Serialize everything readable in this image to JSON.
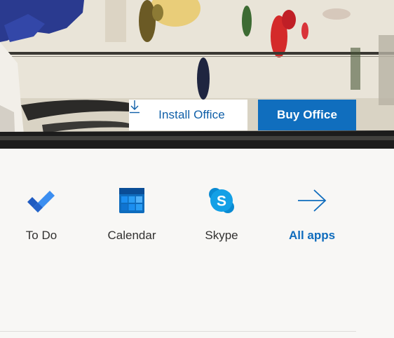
{
  "hero": {
    "install_label": "Install Office",
    "buy_label": "Buy Office",
    "install_icon": "download-icon"
  },
  "apps": [
    {
      "label": "To Do",
      "icon": "todo-icon"
    },
    {
      "label": "Calendar",
      "icon": "calendar-icon"
    },
    {
      "label": "Skype",
      "icon": "skype-icon"
    },
    {
      "label": "All apps",
      "icon": "arrow-right-icon"
    }
  ],
  "colors": {
    "accent": "#106ebe",
    "link": "#0f6cbd",
    "page_bg": "#f8f7f5"
  }
}
